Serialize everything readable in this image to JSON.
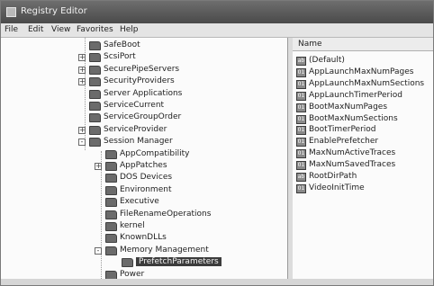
{
  "window": {
    "title": "Registry Editor"
  },
  "menu": [
    "File",
    "Edit",
    "View",
    "Favorites",
    "Help"
  ],
  "tree": [
    {
      "label": "SafeBoot",
      "expander": "",
      "level": 0
    },
    {
      "label": "ScsiPort",
      "expander": "+",
      "level": 0
    },
    {
      "label": "SecurePipeServers",
      "expander": "+",
      "level": 0
    },
    {
      "label": "SecurityProviders",
      "expander": "+",
      "level": 0
    },
    {
      "label": "Server Applications",
      "expander": "",
      "level": 0
    },
    {
      "label": "ServiceCurrent",
      "expander": "",
      "level": 0
    },
    {
      "label": "ServiceGroupOrder",
      "expander": "",
      "level": 0
    },
    {
      "label": "ServiceProvider",
      "expander": "+",
      "level": 0
    },
    {
      "label": "Session Manager",
      "expander": "-",
      "level": 0
    },
    {
      "label": "AppCompatibility",
      "expander": "",
      "level": 1
    },
    {
      "label": "AppPatches",
      "expander": "+",
      "level": 1
    },
    {
      "label": "DOS Devices",
      "expander": "",
      "level": 1
    },
    {
      "label": "Environment",
      "expander": "",
      "level": 1
    },
    {
      "label": "Executive",
      "expander": "",
      "level": 1
    },
    {
      "label": "FileRenameOperations",
      "expander": "",
      "level": 1
    },
    {
      "label": "kernel",
      "expander": "",
      "level": 1
    },
    {
      "label": "KnownDLLs",
      "expander": "",
      "level": 1
    },
    {
      "label": "Memory Management",
      "expander": "-",
      "level": 1
    },
    {
      "label": "PrefetchParameters",
      "expander": "",
      "level": 2,
      "selected": true
    },
    {
      "label": "Power",
      "expander": "",
      "level": 1
    }
  ],
  "values_header": "Name",
  "values": [
    {
      "name": "(Default)",
      "icon": "ab"
    },
    {
      "name": "AppLaunchMaxNumPages",
      "icon": "01"
    },
    {
      "name": "AppLaunchMaxNumSections",
      "icon": "01"
    },
    {
      "name": "AppLaunchTimerPeriod",
      "icon": "01"
    },
    {
      "name": "BootMaxNumPages",
      "icon": "01"
    },
    {
      "name": "BootMaxNumSections",
      "icon": "01"
    },
    {
      "name": "BootTimerPeriod",
      "icon": "01"
    },
    {
      "name": "EnablePrefetcher",
      "icon": "01"
    },
    {
      "name": "MaxNumActiveTraces",
      "icon": "01"
    },
    {
      "name": "MaxNumSavedTraces",
      "icon": "01"
    },
    {
      "name": "RootDirPath",
      "icon": "ab"
    },
    {
      "name": "VideoInitTime",
      "icon": "01"
    }
  ]
}
